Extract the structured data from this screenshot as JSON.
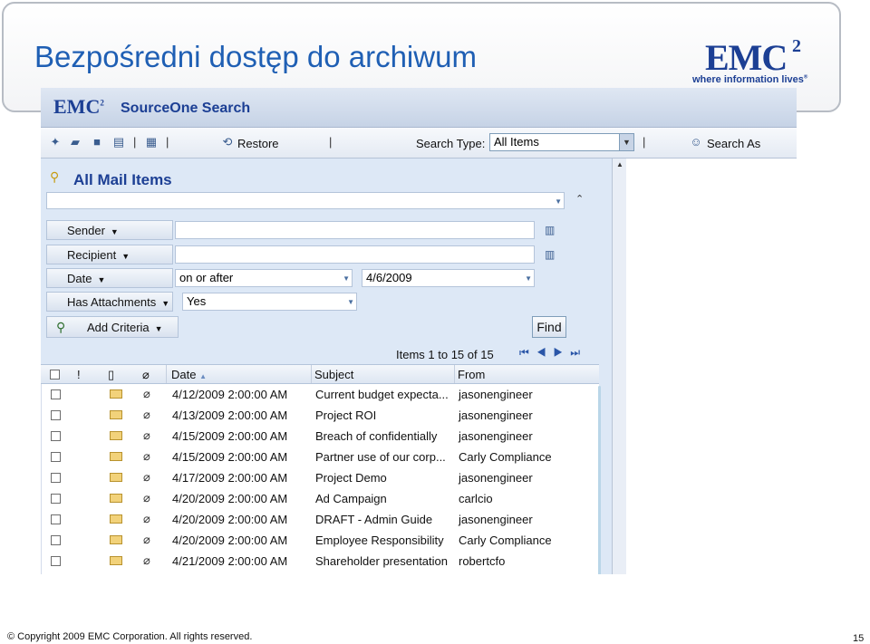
{
  "slide": {
    "title": "Bezpośredni dostęp do archiwum",
    "logo": {
      "word": "EMC",
      "superscript": "2",
      "tagline": "where information lives",
      "tagline_mark": "®"
    },
    "footer": {
      "copyright": "© Copyright 2009 EMC Corporation. All rights reserved.",
      "page_number": "15"
    }
  },
  "app": {
    "brand": "EMC",
    "brand_sup": "2",
    "product": "SourceOne Search",
    "toolbar": {
      "sep": "|",
      "restore_label": "Restore",
      "search_type_label": "Search Type:",
      "search_type_value": "All Items",
      "search_as_label": "Search As"
    },
    "query": {
      "title": "All Mail Items",
      "view_value": "",
      "criteria": [
        {
          "field": "Sender",
          "operator": "",
          "value": ""
        },
        {
          "field": "Recipient",
          "operator": "",
          "value": ""
        },
        {
          "field": "Date",
          "operator": "on or after",
          "value": "4/6/2009"
        },
        {
          "field": "Has Attachments",
          "operator": "Yes",
          "value": ""
        }
      ],
      "add_criteria_label": "Add Criteria",
      "find_label": "Find"
    },
    "results": {
      "pager_text": "Items 1 to 15 of 15",
      "columns": [
        "!",
        "Date",
        "Subject",
        "From"
      ],
      "rows": [
        {
          "date": "4/12/2009 2:00:00 AM",
          "subject": "Current budget expecta...",
          "from": "jasonengineer"
        },
        {
          "date": "4/13/2009 2:00:00 AM",
          "subject": "Project ROI",
          "from": "jasonengineer"
        },
        {
          "date": "4/15/2009 2:00:00 AM",
          "subject": "Breach of confidentially",
          "from": "jasonengineer"
        },
        {
          "date": "4/15/2009 2:00:00 AM",
          "subject": "Partner use of our corp...",
          "from": "Carly Compliance"
        },
        {
          "date": "4/17/2009 2:00:00 AM",
          "subject": "Project Demo",
          "from": "jasonengineer"
        },
        {
          "date": "4/20/2009 2:00:00 AM",
          "subject": "Ad Campaign",
          "from": "carlcio"
        },
        {
          "date": "4/20/2009 2:00:00 AM",
          "subject": "DRAFT - Admin Guide",
          "from": "jasonengineer"
        },
        {
          "date": "4/20/2009 2:00:00 AM",
          "subject": "Employee Responsibility",
          "from": "Carly Compliance"
        },
        {
          "date": "4/21/2009 2:00:00 AM",
          "subject": "Shareholder presentation",
          "from": "robertcfo"
        }
      ]
    }
  },
  "icons": {
    "new": "new-document-icon",
    "open": "open-folder-icon",
    "save": "save-icon",
    "print": "print-icon",
    "properties": "properties-icon",
    "restore": "restore-icon",
    "search_as": "users-icon",
    "query": "search-folder-icon",
    "book": "address-book-icon",
    "add": "add-criteria-icon",
    "envelope": "envelope-icon",
    "attachment": "paperclip-icon"
  },
  "colors": {
    "title_blue": "#1f5fb4",
    "emc_blue": "#1c3f94",
    "pane_bg": "#dde8f6"
  }
}
